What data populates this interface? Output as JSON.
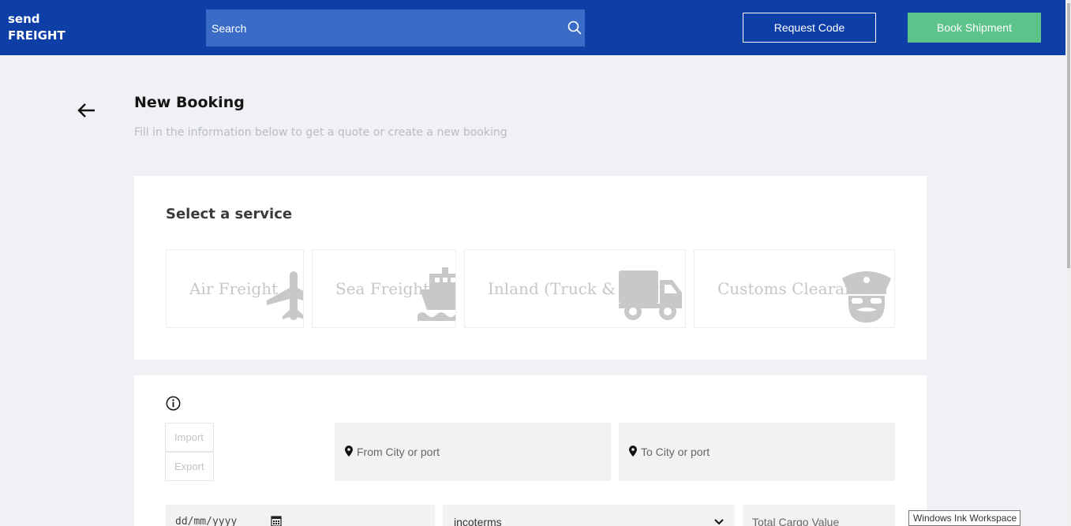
{
  "header": {
    "logo_line1": "send",
    "logo_line2": "FREIGHT",
    "search_placeholder": "Search",
    "request_code_label": "Request Code",
    "book_shipment_label": "Book Shipment",
    "bar_color": "#0d3fa6",
    "book_color": "#5cc38a"
  },
  "page": {
    "title": "New Booking",
    "subtitle": "Fill in the information below to get a quote or create a new booking"
  },
  "services": {
    "heading": "Select a service",
    "items": [
      {
        "label": "Air Freight",
        "icon": "airplane-icon"
      },
      {
        "label": "Sea Freight",
        "icon": "ship-icon"
      },
      {
        "label": "Inland (Truck & Barge)",
        "icon": "truck-icon"
      },
      {
        "label": "Customs Clearance",
        "icon": "customs-officer-icon"
      }
    ]
  },
  "form": {
    "direction_options": [
      "Import",
      "Export"
    ],
    "from_placeholder": "From City or port",
    "to_placeholder": "To City or port",
    "date_placeholder": "dd/mm/yyyy",
    "incoterms_value": "incoterms",
    "cargo_value_placeholder": "Total Cargo Value"
  },
  "system": {
    "tooltip": "Windows Ink Workspace"
  }
}
